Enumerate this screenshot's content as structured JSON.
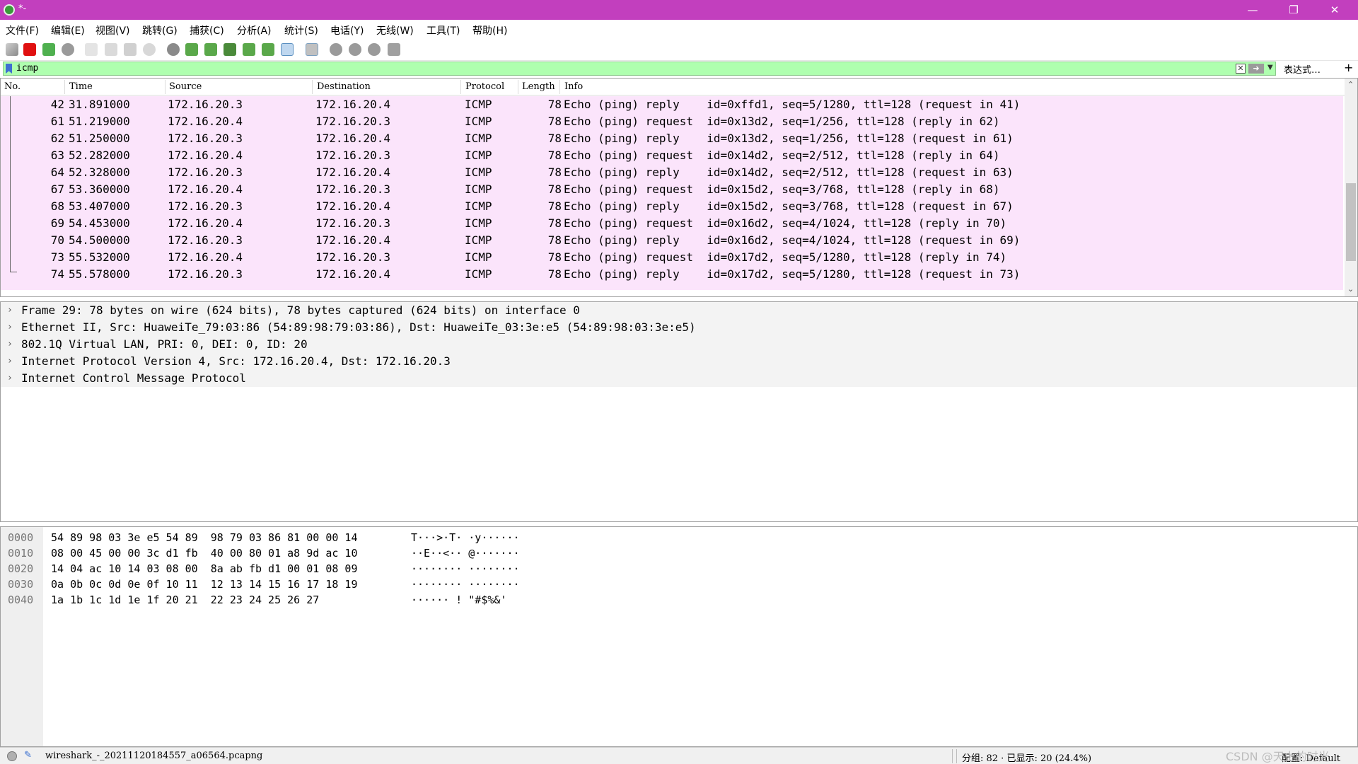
{
  "window": {
    "title": "*-"
  },
  "menu": [
    "文件(F)",
    "编辑(E)",
    "视图(V)",
    "跳转(G)",
    "捕获(C)",
    "分析(A)",
    "统计(S)",
    "电话(Y)",
    "无线(W)",
    "工具(T)",
    "帮助(H)"
  ],
  "toolbar_icons": [
    "shark-fin-start-icon",
    "stop-capture-icon",
    "restart-capture-icon",
    "capture-options-icon",
    "open-file-icon",
    "save-file-icon",
    "close-file-icon",
    "reload-file-icon",
    "find-packet-icon",
    "go-back-icon",
    "go-forward-icon",
    "go-to-packet-icon",
    "first-packet-icon",
    "last-packet-icon",
    "autoscroll-icon",
    "colorize-icon",
    "zoom-in-icon",
    "zoom-out-icon",
    "zoom-normal-icon",
    "resize-columns-icon"
  ],
  "filter": {
    "value": "icmp",
    "expression_label": "表达式…",
    "plus": "+"
  },
  "packet_list": {
    "columns": {
      "no": "No.",
      "time": "Time",
      "source": "Source",
      "destination": "Destination",
      "protocol": "Protocol",
      "length": "Length",
      "info": "Info"
    },
    "rows": [
      {
        "no": "42",
        "time": "31.891000",
        "source": "172.16.20.3",
        "destination": "172.16.20.4",
        "protocol": "ICMP",
        "length": "78",
        "info": "Echo (ping) reply    id=0xffd1, seq=5/1280, ttl=128 (request in 41)"
      },
      {
        "no": "61",
        "time": "51.219000",
        "source": "172.16.20.4",
        "destination": "172.16.20.3",
        "protocol": "ICMP",
        "length": "78",
        "info": "Echo (ping) request  id=0x13d2, seq=1/256, ttl=128 (reply in 62)"
      },
      {
        "no": "62",
        "time": "51.250000",
        "source": "172.16.20.3",
        "destination": "172.16.20.4",
        "protocol": "ICMP",
        "length": "78",
        "info": "Echo (ping) reply    id=0x13d2, seq=1/256, ttl=128 (request in 61)"
      },
      {
        "no": "63",
        "time": "52.282000",
        "source": "172.16.20.4",
        "destination": "172.16.20.3",
        "protocol": "ICMP",
        "length": "78",
        "info": "Echo (ping) request  id=0x14d2, seq=2/512, ttl=128 (reply in 64)"
      },
      {
        "no": "64",
        "time": "52.328000",
        "source": "172.16.20.3",
        "destination": "172.16.20.4",
        "protocol": "ICMP",
        "length": "78",
        "info": "Echo (ping) reply    id=0x14d2, seq=2/512, ttl=128 (request in 63)"
      },
      {
        "no": "67",
        "time": "53.360000",
        "source": "172.16.20.4",
        "destination": "172.16.20.3",
        "protocol": "ICMP",
        "length": "78",
        "info": "Echo (ping) request  id=0x15d2, seq=3/768, ttl=128 (reply in 68)"
      },
      {
        "no": "68",
        "time": "53.407000",
        "source": "172.16.20.3",
        "destination": "172.16.20.4",
        "protocol": "ICMP",
        "length": "78",
        "info": "Echo (ping) reply    id=0x15d2, seq=3/768, ttl=128 (request in 67)"
      },
      {
        "no": "69",
        "time": "54.453000",
        "source": "172.16.20.4",
        "destination": "172.16.20.3",
        "protocol": "ICMP",
        "length": "78",
        "info": "Echo (ping) request  id=0x16d2, seq=4/1024, ttl=128 (reply in 70)"
      },
      {
        "no": "70",
        "time": "54.500000",
        "source": "172.16.20.3",
        "destination": "172.16.20.4",
        "protocol": "ICMP",
        "length": "78",
        "info": "Echo (ping) reply    id=0x16d2, seq=4/1024, ttl=128 (request in 69)"
      },
      {
        "no": "73",
        "time": "55.532000",
        "source": "172.16.20.4",
        "destination": "172.16.20.3",
        "protocol": "ICMP",
        "length": "78",
        "info": "Echo (ping) request  id=0x17d2, seq=5/1280, ttl=128 (reply in 74)"
      },
      {
        "no": "74",
        "time": "55.578000",
        "source": "172.16.20.3",
        "destination": "172.16.20.4",
        "protocol": "ICMP",
        "length": "78",
        "info": "Echo (ping) reply    id=0x17d2, seq=5/1280, ttl=128 (request in 73)"
      }
    ]
  },
  "details": [
    "Frame 29: 78 bytes on wire (624 bits), 78 bytes captured (624 bits) on interface 0",
    "Ethernet II, Src: HuaweiTe_79:03:86 (54:89:98:79:03:86), Dst: HuaweiTe_03:3e:e5 (54:89:98:03:3e:e5)",
    "802.1Q Virtual LAN, PRI: 0, DEI: 0, ID: 20",
    "Internet Protocol Version 4, Src: 172.16.20.4, Dst: 172.16.20.3",
    "Internet Control Message Protocol"
  ],
  "bytes": [
    {
      "offset": "0000",
      "hex": "54 89 98 03 3e e5 54 89  98 79 03 86 81 00 00 14",
      "ascii": "T···>·T· ·y······"
    },
    {
      "offset": "0010",
      "hex": "08 00 45 00 00 3c d1 fb  40 00 80 01 a8 9d ac 10",
      "ascii": "··E··<·· @·······"
    },
    {
      "offset": "0020",
      "hex": "14 04 ac 10 14 03 08 00  8a ab fb d1 00 01 08 09",
      "ascii": "········ ········"
    },
    {
      "offset": "0030",
      "hex": "0a 0b 0c 0d 0e 0f 10 11  12 13 14 15 16 17 18 19",
      "ascii": "········ ········"
    },
    {
      "offset": "0040",
      "hex": "1a 1b 1c 1d 1e 1f 20 21  22 23 24 25 26 27",
      "ascii": "······ ! \"#$%&'"
    }
  ],
  "status": {
    "file": "wireshark_-_20211120184557_a06564.pcapng",
    "packets": "分组: 82 · 已显示: 20 (24.4%)",
    "profile": "配置: Default",
    "watermark": "CSDN @天上的时光"
  },
  "colors": {
    "title_bar": "#c23fbe",
    "filter_bg": "#afffaf",
    "icmp_row": "#fbe4fb"
  }
}
